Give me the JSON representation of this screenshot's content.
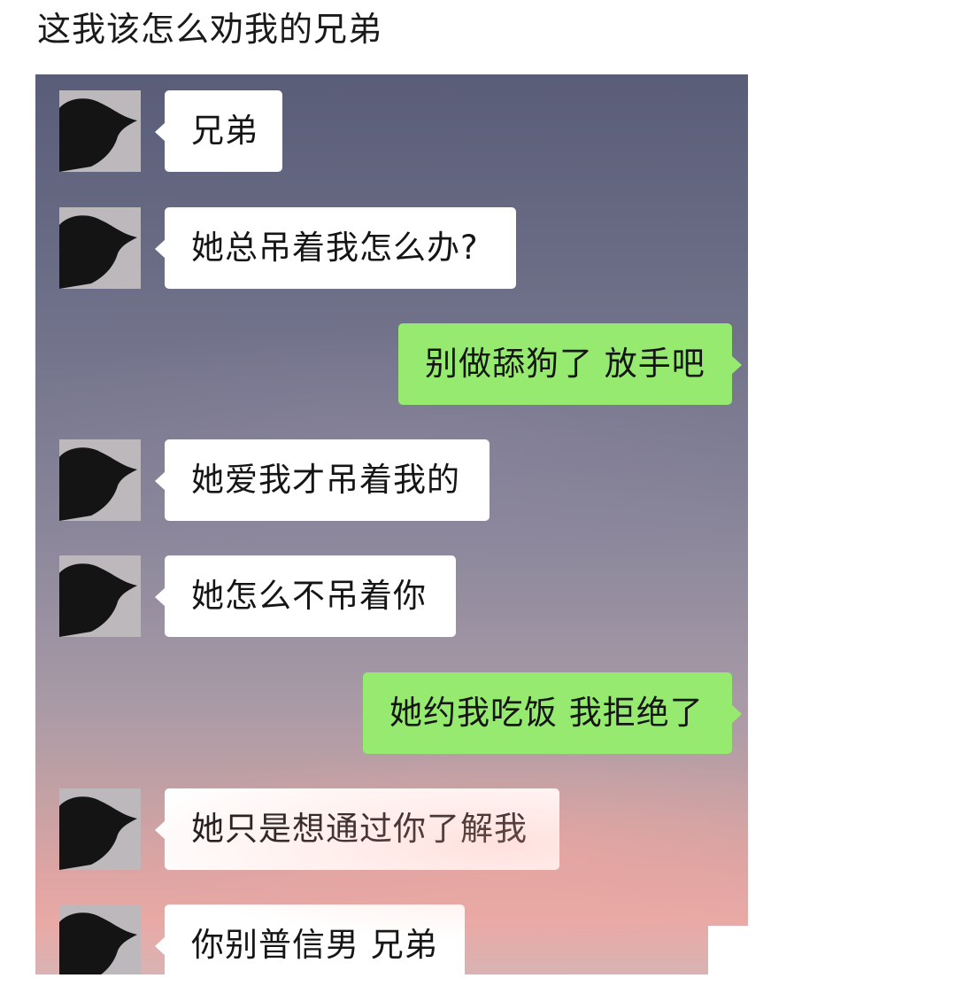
{
  "post": {
    "title": "这我该怎么劝我的兄弟"
  },
  "chat": {
    "messages": [
      {
        "side": "left",
        "text": "兄弟"
      },
      {
        "side": "left",
        "text": "她总吊着我怎么办?"
      },
      {
        "side": "right",
        "text": "别做舔狗了 放手吧"
      },
      {
        "side": "left",
        "text": "她爱我才吊着我的"
      },
      {
        "side": "left",
        "text": "她怎么不吊着你"
      },
      {
        "side": "right",
        "text": "她约我吃饭 我拒绝了"
      },
      {
        "side": "left",
        "text": "她只是想通过你了解我"
      },
      {
        "side": "left",
        "text": "你别普信男 兄弟"
      }
    ],
    "colors": {
      "incoming_bubble": "#ffffff",
      "outgoing_bubble": "#96ea70"
    },
    "avatar_icon": "silhouette-avatar-icon"
  }
}
